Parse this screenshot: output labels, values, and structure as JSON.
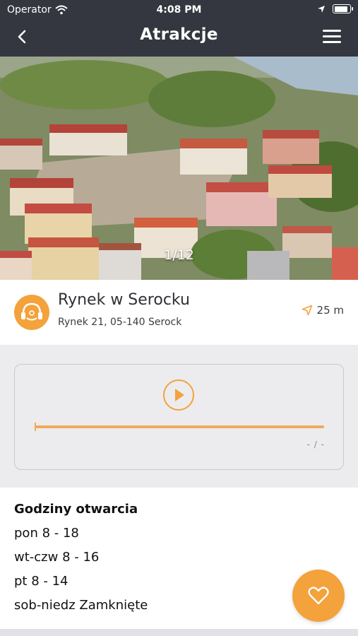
{
  "status_bar": {
    "carrier": "Operator",
    "time": "4:08 PM"
  },
  "header": {
    "title": "Atrakcje",
    "icons": [
      "back-chevron-icon",
      "hamburger-menu-icon"
    ]
  },
  "gallery": {
    "counter": "1/12"
  },
  "attraction": {
    "name": "Rynek w Serocku",
    "address": "Rynek 21, 05-140 Serock",
    "distance": "25 m",
    "icon": "audio-guide-logo-icon"
  },
  "audio_player": {
    "duration": "- / -",
    "progress": 1.0,
    "icon": "play-icon"
  },
  "opening_hours": {
    "heading": "Godziny otwarcia",
    "rows": [
      "pon 8 - 18",
      "wt-czw 8 - 16",
      "pt 8 - 14",
      "sob-niedz Zamknięte"
    ]
  },
  "favorite_button": {
    "icon": "heart-outline-icon"
  },
  "colors": {
    "header_bg": "#34373f",
    "accent": "#f4a23b",
    "background": "#ececef"
  }
}
